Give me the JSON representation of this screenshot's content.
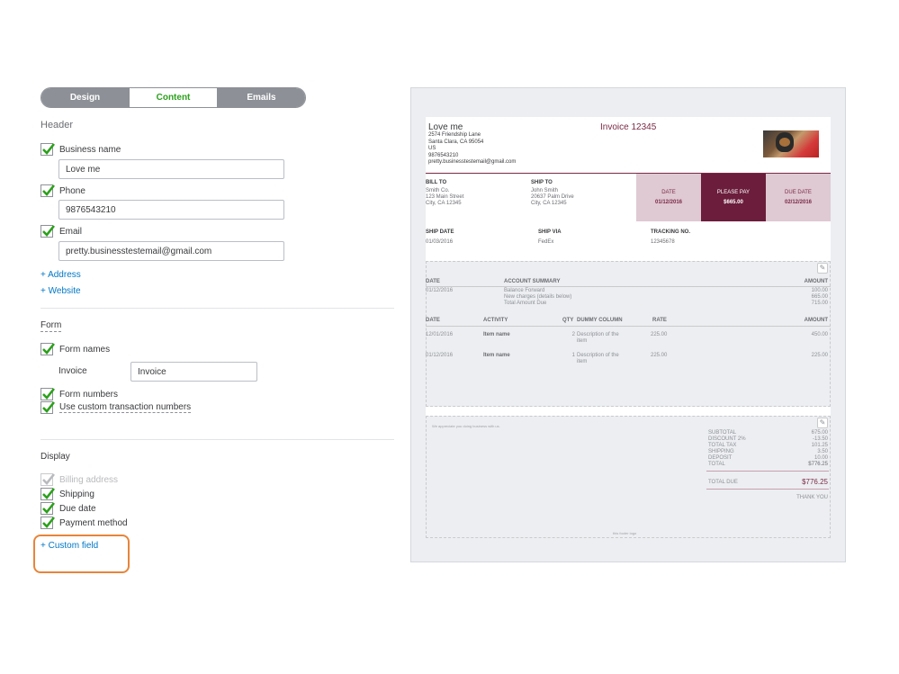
{
  "tabs": [
    {
      "label": "Design",
      "active": false
    },
    {
      "label": "Content",
      "active": true
    },
    {
      "label": "Emails",
      "active": false
    }
  ],
  "header_section": {
    "title": "Header",
    "business_name": {
      "label": "Business name",
      "checked": true,
      "value": "Love me"
    },
    "phone": {
      "label": "Phone",
      "checked": true,
      "value": "9876543210"
    },
    "email": {
      "label": "Email",
      "checked": true,
      "value": "pretty.businesstestemail@gmail.com"
    },
    "add_address": "+ Address",
    "add_website": "+ Website"
  },
  "form_section": {
    "title": "Form",
    "form_names": {
      "label": "Form names",
      "checked": true
    },
    "invoice_label": "Invoice",
    "invoice_value": "Invoice",
    "form_numbers": {
      "label": "Form numbers",
      "checked": true
    },
    "custom_numbers": {
      "label": "Use custom transaction numbers",
      "checked": true
    }
  },
  "display_section": {
    "title": "Display",
    "items": [
      {
        "label": "Billing address",
        "checked": true,
        "disabled": true
      },
      {
        "label": "Shipping",
        "checked": true,
        "disabled": false
      },
      {
        "label": "Due date",
        "checked": true,
        "disabled": false
      },
      {
        "label": "Payment method",
        "checked": true,
        "disabled": false
      }
    ],
    "add_custom_field": "+ Custom field"
  },
  "colors": {
    "accent_green": "#2ca01c",
    "link_blue": "#0077c5",
    "invoice_maroon": "#6b1d3b",
    "highlight_orange": "#e8843a"
  },
  "invoice": {
    "company_name": "Love me",
    "company_lines": [
      "2574 Friendship Lane",
      "Santa Clara, CA 95054",
      "US",
      "9876543210",
      "pretty.businesstestemail@gmail.com"
    ],
    "title": "Invoice 12345",
    "bill_to": {
      "label": "BILL TO",
      "lines": [
        "Smith Co.",
        "123 Main Street",
        "City, CA 12345"
      ]
    },
    "ship_to": {
      "label": "SHIP TO",
      "lines": [
        "John Smith",
        "20637 Palm Drive",
        "City, CA 12345"
      ]
    },
    "date": {
      "label": "DATE",
      "value": "01/12/2016"
    },
    "please_pay": {
      "label": "PLEASE PAY",
      "value": "$665.00"
    },
    "due_date": {
      "label": "DUE DATE",
      "value": "02/12/2016"
    },
    "ship_date": {
      "label": "SHIP DATE",
      "value": "01/03/2016"
    },
    "ship_via": {
      "label": "SHIP VIA",
      "value": "FedEx"
    },
    "tracking": {
      "label": "TRACKING NO.",
      "value": "12345678"
    },
    "summary": {
      "headers": {
        "date": "DATE",
        "summary": "ACCOUNT SUMMARY",
        "amount": "AMOUNT"
      },
      "date": "01/12/2016",
      "lines": [
        "Balance Forward",
        "New charges (details below)",
        "Total Amount Due"
      ],
      "amounts": [
        "100.00",
        "665.00",
        "715.00"
      ]
    },
    "items": {
      "headers": {
        "date": "DATE",
        "activity": "ACTIVITY",
        "qty": "QTY",
        "dummy": "DUMMY COLUMN",
        "rate": "RATE",
        "amount": "AMOUNT"
      },
      "rows": [
        {
          "date": "12/01/2016",
          "activity": "Item name",
          "qty": "2",
          "desc1": "Description of the",
          "desc2": "item",
          "rate": "225.00",
          "amount": "450.00"
        },
        {
          "date": "01/12/2016",
          "activity": "Item name",
          "qty": "1",
          "desc1": "Description of the",
          "desc2": "item",
          "rate": "225.00",
          "amount": "225.00"
        }
      ]
    },
    "message": "We appreciate you doing business with us.",
    "totals": {
      "labels": [
        "SUBTOTAL",
        "DISCOUNT 2%",
        "TOTAL TAX",
        "SHIPPING",
        "DEPOSIT",
        "TOTAL"
      ],
      "values": [
        "675.00",
        "-13.50",
        "101.25",
        "3.50",
        "10.00",
        "$776.25"
      ],
      "total_due_label": "TOTAL DUE",
      "total_due_value": "$776.25",
      "thank_you": "THANK YOU"
    },
    "footer": "this footer logo"
  }
}
